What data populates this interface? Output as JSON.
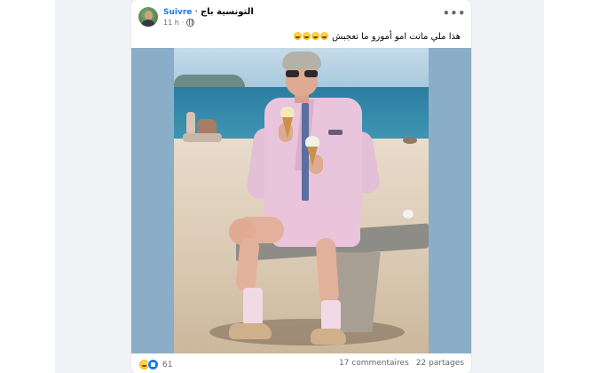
{
  "post": {
    "page_name": "التونسية باج",
    "follow_label": "Suivre",
    "separator": "·",
    "time": "11 h",
    "more_label": "•••",
    "text": "هذا ملي ماتت امو أمورو ما تعجبش"
  },
  "footer": {
    "reaction_count": "61",
    "comments": "17 commentaires",
    "shares": "22 partages"
  },
  "icons": {
    "globe": "globe-icon",
    "more": "more-options-icon",
    "haha": "haha-reaction-icon",
    "like": "like-reaction-icon",
    "laugh_emoji": "laughing-emoji-icon"
  }
}
